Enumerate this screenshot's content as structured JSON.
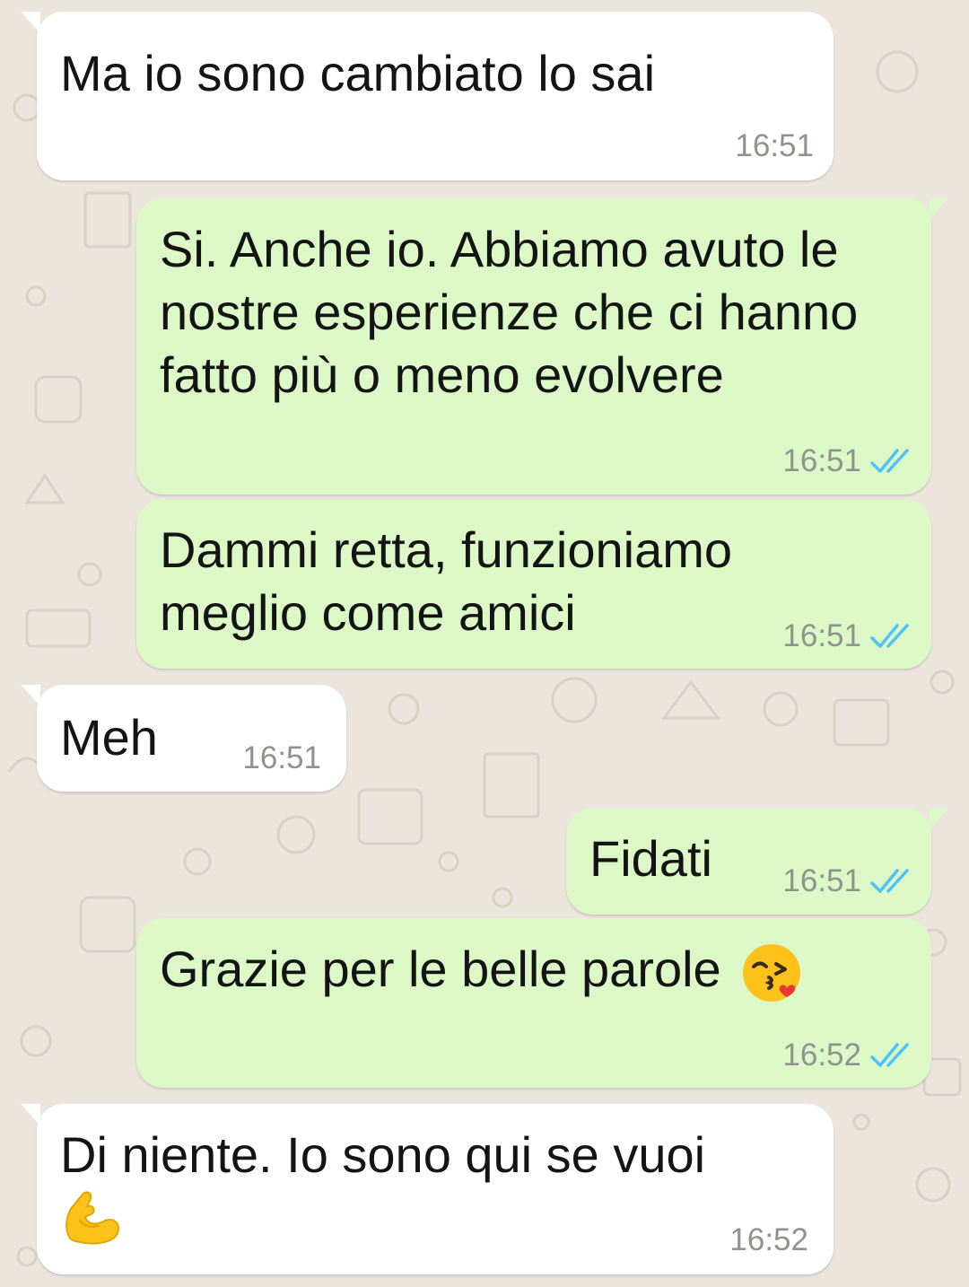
{
  "chat": {
    "messages": [
      {
        "direction": "in",
        "text": "Ma io sono cambiato lo sai",
        "time": "16:51"
      },
      {
        "direction": "out",
        "text": "Si. Anche io. Abbiamo avuto le\nnostre esperienze che ci hanno\nfatto più o meno evolvere",
        "time": "16:51",
        "status": "read"
      },
      {
        "direction": "out",
        "text": "Dammi retta, funzioniamo\nmeglio come amici",
        "time": "16:51",
        "status": "read"
      },
      {
        "direction": "in",
        "text": "Meh",
        "time": "16:51"
      },
      {
        "direction": "out",
        "text": "Fidati",
        "time": "16:51",
        "status": "read"
      },
      {
        "direction": "out",
        "text": "Grazie per le belle parole",
        "emoji": "kissing-heart-emoji",
        "time": "16:52",
        "status": "read"
      },
      {
        "direction": "in",
        "text": "Di niente. Io sono qui se vuoi",
        "emoji": "flexed-biceps-emoji",
        "time": "16:52"
      }
    ]
  },
  "colors": {
    "background": "#ece5dd",
    "incoming_bubble": "#ffffff",
    "outgoing_bubble": "#dcf8c6",
    "timestamp": "#8e948d",
    "read_ticks": "#4fc3f7"
  }
}
